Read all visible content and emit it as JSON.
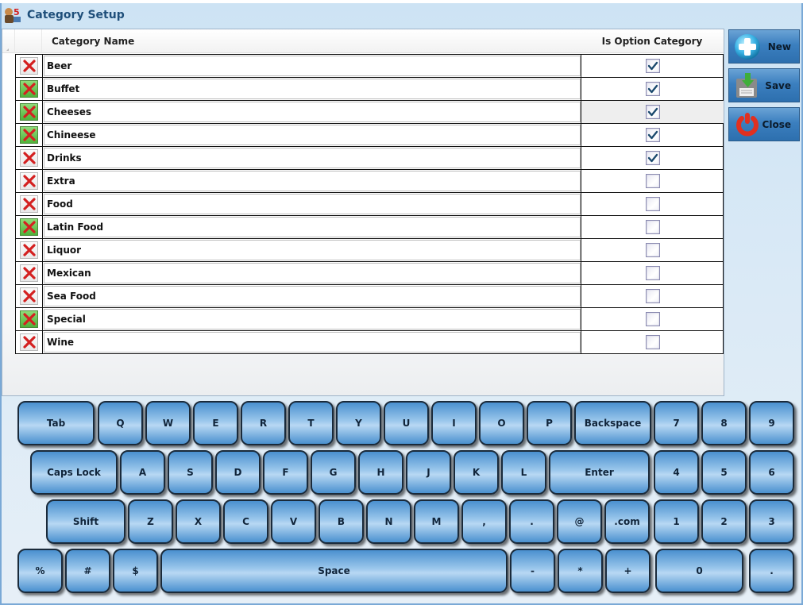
{
  "window": {
    "title": "Category Setup",
    "icon": "app-logo-icon"
  },
  "grid": {
    "columns": {
      "delete": "",
      "name": "Category Name",
      "option": "Is Option Category"
    },
    "rows": [
      {
        "name": "Beer",
        "is_option": true,
        "delete_style": "plain"
      },
      {
        "name": "Buffet",
        "is_option": true,
        "delete_style": "green"
      },
      {
        "name": "Cheeses",
        "is_option": true,
        "delete_style": "green",
        "selected": true
      },
      {
        "name": "Chineese",
        "is_option": true,
        "delete_style": "green"
      },
      {
        "name": "Drinks",
        "is_option": true,
        "delete_style": "plain"
      },
      {
        "name": "Extra",
        "is_option": false,
        "delete_style": "plain"
      },
      {
        "name": "Food",
        "is_option": false,
        "delete_style": "plain"
      },
      {
        "name": "Latin Food",
        "is_option": false,
        "delete_style": "green"
      },
      {
        "name": "Liquor",
        "is_option": false,
        "delete_style": "plain"
      },
      {
        "name": "Mexican",
        "is_option": false,
        "delete_style": "plain"
      },
      {
        "name": "Sea Food",
        "is_option": false,
        "delete_style": "plain"
      },
      {
        "name": "Special",
        "is_option": false,
        "delete_style": "green"
      },
      {
        "name": "Wine",
        "is_option": false,
        "delete_style": "plain"
      }
    ]
  },
  "actions": {
    "new_label": "New",
    "save_label": "Save",
    "close_label": "Close"
  },
  "keyboard": {
    "rows": [
      [
        "Tab",
        "Q",
        "W",
        "E",
        "R",
        "T",
        "Y",
        "U",
        "I",
        "O",
        "P",
        "Backspace",
        "7",
        "8",
        "9"
      ],
      [
        "Caps Lock",
        "A",
        "S",
        "D",
        "F",
        "G",
        "H",
        "J",
        "K",
        "L",
        "Enter",
        "4",
        "5",
        "6"
      ],
      [
        "Shift",
        "Z",
        "X",
        "C",
        "V",
        "B",
        "N",
        "M",
        ",",
        ".",
        "@",
        ".com",
        "1",
        "2",
        "3"
      ],
      [
        "%",
        "#",
        "$",
        "Space",
        "-",
        "*",
        "+",
        "0",
        "."
      ]
    ]
  },
  "colors": {
    "accent": "#3b7fbf",
    "title_text": "#1f4f7a",
    "delete_green": "#4fb33a",
    "delete_x": "#d42020",
    "check": "#1c4a6e"
  }
}
